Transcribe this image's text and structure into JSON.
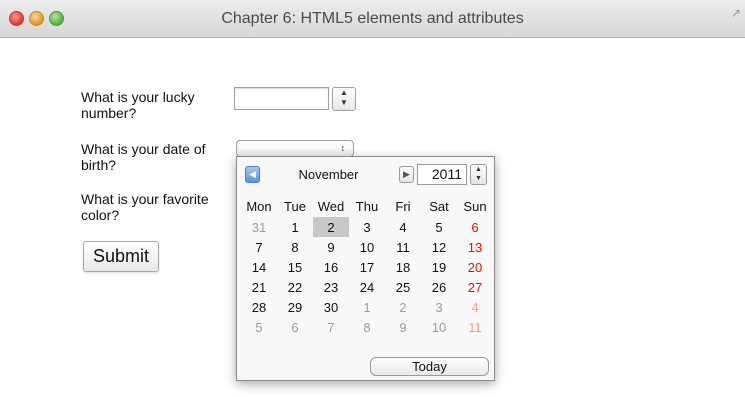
{
  "window": {
    "title": "Chapter 6: HTML5 elements and attributes"
  },
  "form": {
    "lucky_label": "What is your lucky number?",
    "lucky_value": "",
    "dob_label": "What is your date of birth?",
    "dob_value": "",
    "color_label": "What is your favorite color?",
    "submit_label": "Submit"
  },
  "datepicker": {
    "month": "November",
    "year": "2011",
    "today_label": "Today",
    "weekdays": [
      "Mon",
      "Tue",
      "Wed",
      "Thu",
      "Fri",
      "Sat",
      "Sun"
    ],
    "selected_day": "2",
    "weeks": [
      [
        "31",
        "1",
        "2",
        "3",
        "4",
        "5",
        "6"
      ],
      [
        "7",
        "8",
        "9",
        "10",
        "11",
        "12",
        "13"
      ],
      [
        "14",
        "15",
        "16",
        "17",
        "18",
        "19",
        "20"
      ],
      [
        "21",
        "22",
        "23",
        "24",
        "25",
        "26",
        "27"
      ],
      [
        "28",
        "29",
        "30",
        "1",
        "2",
        "3",
        "4"
      ],
      [
        "5",
        "6",
        "7",
        "8",
        "9",
        "10",
        "11"
      ]
    ],
    "colors": {
      "weekend": "#e01010",
      "selected_bg": "#c8c8c8",
      "other_month": "#9b9b9b"
    }
  },
  "icons": {
    "close": "close-button-icon",
    "minimize": "minimize-button-icon",
    "zoom": "zoom-button-icon",
    "fullscreen": "fullscreen-icon",
    "prev": "chevron-left-icon",
    "next": "chevron-right-icon"
  }
}
